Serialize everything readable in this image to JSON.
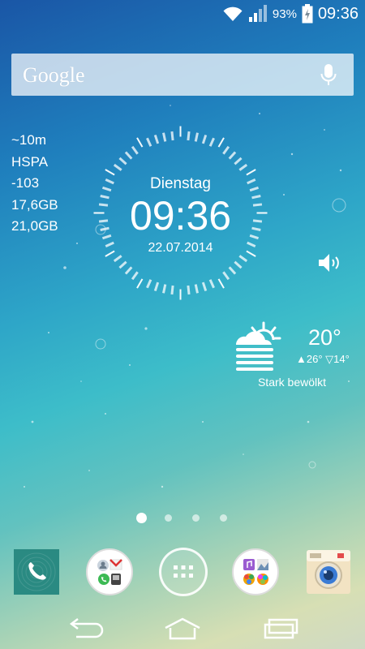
{
  "status_bar": {
    "battery_percent": "93%",
    "time": "09:36",
    "wifi_icon": "wifi-icon",
    "signal_icon": "signal-icon",
    "battery_icon": "battery-charging-icon"
  },
  "search": {
    "label": "Google",
    "mic_icon": "mic-icon"
  },
  "info_widget": {
    "lines": [
      "~10m",
      "HSPA",
      "-103",
      "17,6GB",
      "21,0GB"
    ]
  },
  "clock_widget": {
    "day": "Dienstag",
    "time": "09:36",
    "date": "22.07.2014"
  },
  "weather": {
    "temperature": "20°",
    "high_low": "▲26° ▽14°",
    "condition": "Stark bewölkt",
    "icon": "cloudy-sun-icon"
  },
  "home_pages": {
    "count": 4,
    "active": 1
  },
  "dock": {
    "items": [
      {
        "name": "phone-app",
        "icon": "phone-icon"
      },
      {
        "name": "communication-folder",
        "icon": "folder-icon"
      },
      {
        "name": "apps-button",
        "icon": "apps-grid-icon"
      },
      {
        "name": "media-folder",
        "icon": "folder-icon"
      },
      {
        "name": "camera-app",
        "icon": "camera-icon"
      }
    ]
  },
  "nav_bar": {
    "back_icon": "back-icon",
    "home_icon": "home-icon",
    "recents_icon": "recents-icon"
  },
  "colors": {
    "phone_app": "#2a8a82",
    "camera_body": "#f2e3c3",
    "camera_lens": "#3a7bd5"
  }
}
